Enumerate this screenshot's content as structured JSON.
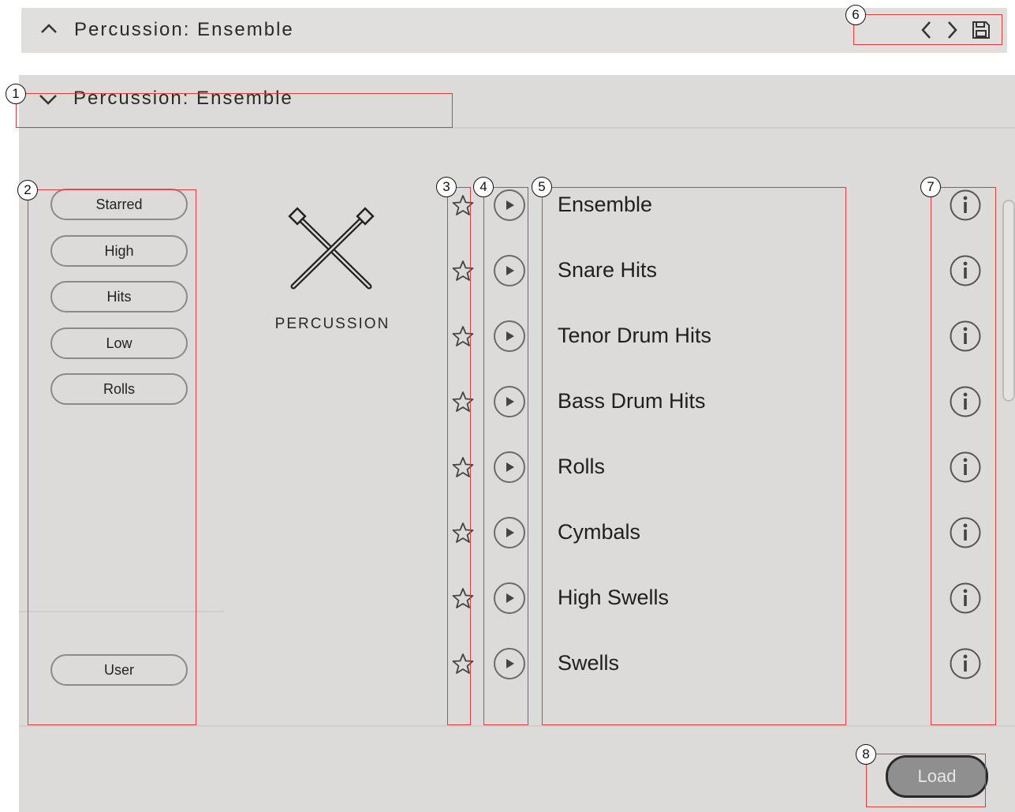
{
  "top_bar": {
    "title": "Percussion: Ensemble"
  },
  "panel": {
    "title": "Percussion: Ensemble",
    "category": {
      "label": "PERCUSSION",
      "icon": "crossed-mallets-icon"
    },
    "filters": [
      "Starred",
      "High",
      "Hits",
      "Low",
      "Rolls"
    ],
    "user_filter": "User",
    "presets": [
      "Ensemble",
      "Snare Hits",
      "Tenor Drum Hits",
      "Bass Drum Hits",
      "Rolls",
      "Cymbals",
      "High Swells",
      "Swells"
    ],
    "load_label": "Load"
  },
  "annotations": [
    "1",
    "2",
    "3",
    "4",
    "5",
    "6",
    "7",
    "8"
  ],
  "colors": {
    "panel_bg": "#dcdbda",
    "annotation_box": "#e23b3b",
    "load_button": "#8f8f8f"
  }
}
